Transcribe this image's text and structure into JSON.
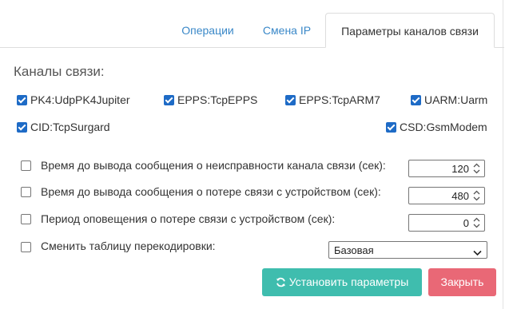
{
  "tabs": [
    {
      "label": "Операции"
    },
    {
      "label": "Смена IP"
    },
    {
      "label": "Параметры каналов связи"
    }
  ],
  "active_tab": "Параметры каналов связи",
  "channels": {
    "title": "Каналы связи:",
    "items": [
      {
        "label": "PK4:UdpPK4Jupiter",
        "checked": true
      },
      {
        "label": "EPPS:TcpEPPS",
        "checked": true
      },
      {
        "label": "EPPS:TcpARM7",
        "checked": true
      },
      {
        "label": "UARM:Uarm",
        "checked": true
      },
      {
        "label": "CID:TcpSurgard",
        "checked": true
      },
      {
        "label": "CSD:GsmModem",
        "checked": true
      }
    ]
  },
  "settings": [
    {
      "label": "Время до вывода сообщения о неисправности канала связи (сек):",
      "checked": false,
      "value": "120"
    },
    {
      "label": "Время до вывода сообщения о потере связи с устройством (сек):",
      "checked": false,
      "value": "480"
    },
    {
      "label": "Период оповещения о потере связи с устройством (сек):",
      "checked": false,
      "value": "0"
    },
    {
      "label": "Сменить таблицу перекодировки:",
      "checked": false,
      "selected": "Базовая"
    }
  ],
  "buttons": {
    "apply": "Установить параметры",
    "close": "Закрыть"
  },
  "colors": {
    "checkbox": "#1e6bc6",
    "tab_link": "#3a88c8",
    "apply_button": "#3fbdae",
    "close_button": "#e96876"
  },
  "icons": {
    "apply": "refresh-icon",
    "spinner": "spinner-arrows-icon",
    "select": "chevron-down-icon"
  }
}
